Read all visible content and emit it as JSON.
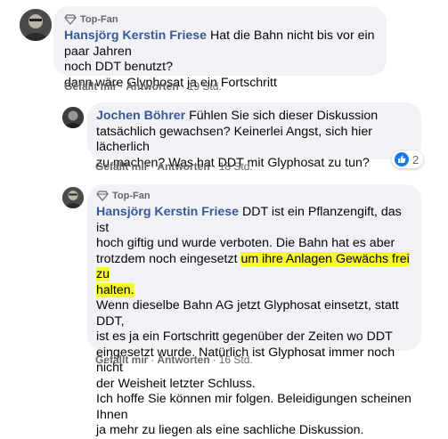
{
  "comments": [
    {
      "badge": "Top-Fan",
      "author": "Hansjörg Kerstin Friese",
      "text_line1": " Hat die Bahn nicht bis vor ein paar Jahren",
      "text_line2": "noch DDT benutzt?",
      "text_line3": "dann wäre Glyphosat ja ein Fortschritt",
      "like_label": "Gefällt mir",
      "reply_label": "Antworten",
      "time": "19 Std."
    },
    {
      "author": "Jochen Böhrer",
      "text_line1": " Fühlen Sie sich dieser Diskussion",
      "text_line2": "tatsächlich gewachsen? Keinerlei Angst, sich hier lächerlich",
      "text_line3": "zu machen? Was hat DDT mit Glyphosat zu tun?",
      "like_label": "Gefällt mir",
      "reply_label": "Antworten",
      "time": "18 Std.",
      "reaction_count": "2"
    },
    {
      "badge": "Top-Fan",
      "author": "Hansjörg Kerstin Friese",
      "text_line1": " DDT ist ein Pflanzengift, das ist",
      "text_line2": "hoch giftig und wurde verboten. Die Bahn hat es aber",
      "text_line3a": "trotzdem noch eingesetzt ",
      "text_line3b": "um ihre Anlagen Gewächs frei zu",
      "text_line4": "halten.",
      "text_line5": "Wenn dieselbe Bahn AG jetzt Glyphosat einsetzt, statt DDT,",
      "text_line6": "ist es ja ein Fortschritt gegenüber der Zeiten wo DDT",
      "text_line7": "eingesetzt wurde. Natürlich ist Glyphosat immer noch nicht",
      "text_line8": "der Weisheit letzter Schluss.",
      "text_line9": "Ich hoffe Sie können mir folgen. Beleidigungen scheinen Ihnen",
      "text_line10": "ja mehr zu liegen als eine sachliche Diskussion.",
      "like_label": "Gefällt mir",
      "reply_label": "Antworten",
      "time": "16 Std."
    }
  ],
  "separator": "·",
  "colors": {
    "author": "#385898",
    "bubble": "#f0f2f5",
    "highlight": "#f7f730",
    "like": "#1877f2"
  }
}
